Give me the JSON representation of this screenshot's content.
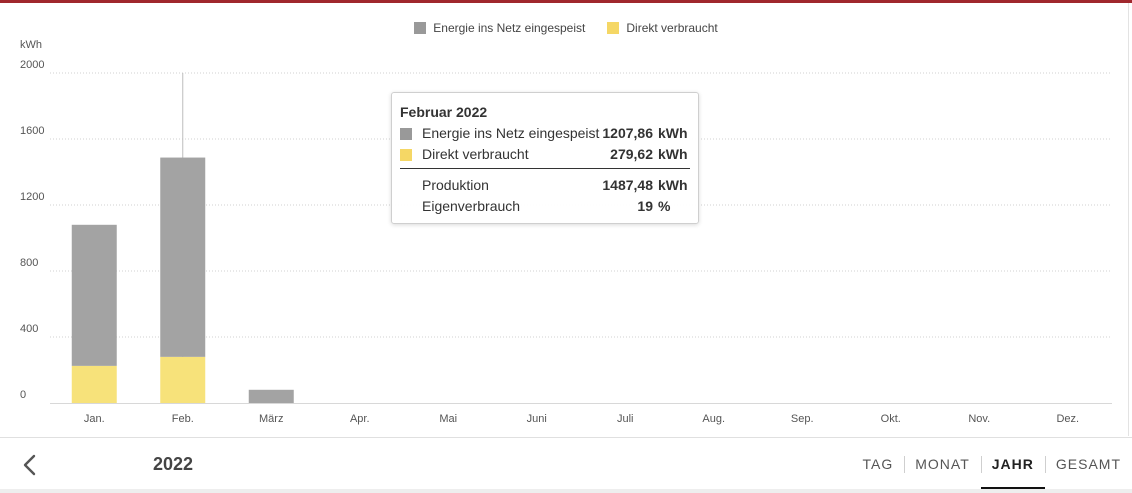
{
  "colors": {
    "accent": "#a0282d",
    "grid": "#d2d2d2",
    "axis_text": "#555555",
    "grey_series": "#a3a3a3",
    "yellow_series": "#f7e27a",
    "grey_swatch": "#999999",
    "yellow_swatch": "#f5d765"
  },
  "legend": [
    {
      "name": "Energie ins Netz eingespeist",
      "color": "#999999"
    },
    {
      "name": "Direkt verbraucht",
      "color": "#f5d765"
    }
  ],
  "chart_data": {
    "type": "bar",
    "stacked": true,
    "ylabel": "kWh",
    "ylim": [
      0,
      2000
    ],
    "yticks": [
      0,
      400,
      800,
      1200,
      1600,
      2000
    ],
    "grid": true,
    "legend_position": "top-center",
    "categories": [
      "Jan.",
      "Feb.",
      "März",
      "Apr.",
      "Mai",
      "Juni",
      "Juli",
      "Aug.",
      "Sep.",
      "Okt.",
      "Nov.",
      "Dez."
    ],
    "series": [
      {
        "name": "Direkt verbraucht",
        "color": "#f7e27a",
        "values": [
          225,
          279.62,
          0,
          0,
          0,
          0,
          0,
          0,
          0,
          0,
          0,
          0
        ]
      },
      {
        "name": "Energie ins Netz eingespeist",
        "color": "#a3a3a3",
        "values": [
          855,
          1207.86,
          80,
          0,
          0,
          0,
          0,
          0,
          0,
          0,
          0,
          0
        ]
      }
    ],
    "highlight_category": "Feb."
  },
  "tooltip": {
    "title": "Februar 2022",
    "rows": [
      {
        "label": "Energie ins Netz eingespeist",
        "value": "1207,86",
        "unit": "kWh",
        "color": "#999999"
      },
      {
        "label": "Direkt verbraucht",
        "value": "279,62",
        "unit": "kWh",
        "color": "#f5d765"
      }
    ],
    "summary": [
      {
        "label": "Produktion",
        "value": "1487,48",
        "unit": "kWh"
      },
      {
        "label": "Eigenverbrauch",
        "value": "19",
        "unit": "%"
      }
    ]
  },
  "bottom": {
    "year": "2022",
    "tabs": [
      {
        "label": "TAG",
        "active": false
      },
      {
        "label": "MONAT",
        "active": false
      },
      {
        "label": "JAHR",
        "active": true
      },
      {
        "label": "GESAMT",
        "active": false
      }
    ]
  }
}
